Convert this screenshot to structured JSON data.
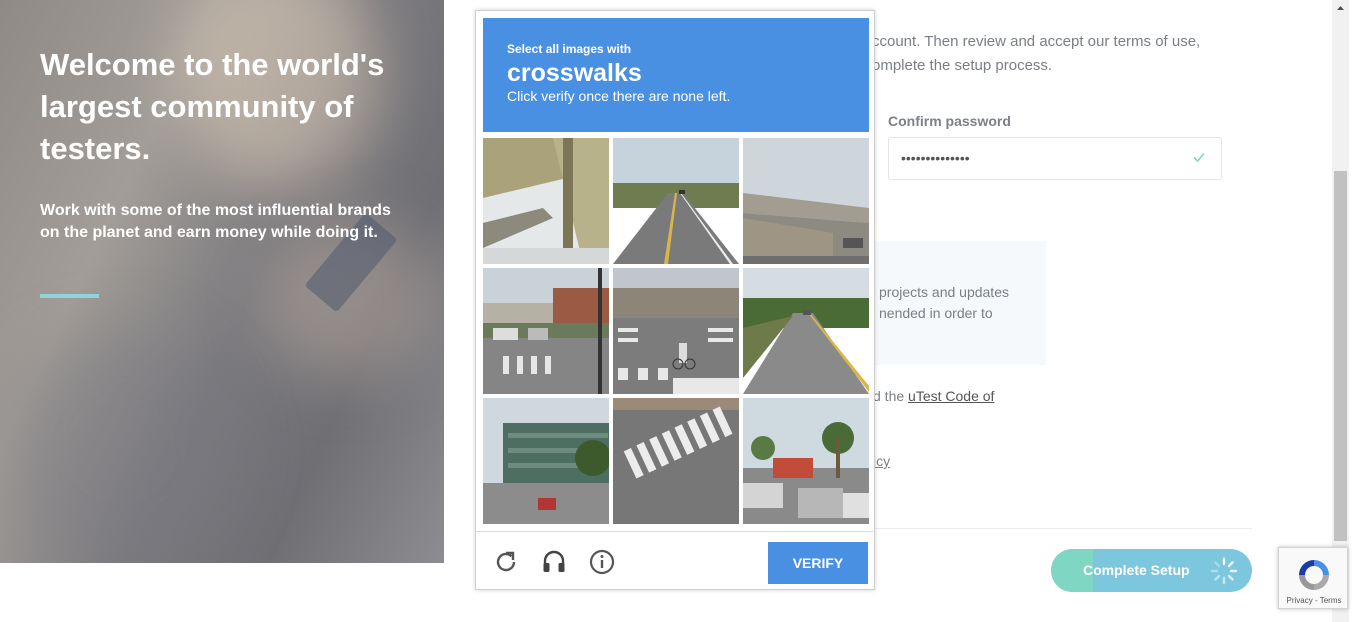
{
  "hero": {
    "title": "Welcome to the world's largest community of testers.",
    "subtitle": "Work with some of the most influential brands on the planet and earn money while doing it."
  },
  "form": {
    "intro_line1": "ccount. Then review and accept our terms of use,",
    "intro_line2": "omplete the setup process.",
    "confirm_label": "Confirm password",
    "confirm_value": "••••••••••••••",
    "info_line1": "projects and updates",
    "info_line2": "nended in order to",
    "code_prefix": "d the ",
    "code_link": "uTest Code of",
    "policy_fragment": "icy",
    "complete_label": "Complete Setup"
  },
  "captcha": {
    "instruction": "Select all images with",
    "keyword": "crosswalks",
    "note": "Click verify once there are none left.",
    "verify_label": "VERIFY",
    "icons": [
      "reload-icon",
      "headphones-icon",
      "info-icon"
    ],
    "tiles": [
      "overpass-underside",
      "two-lane-road",
      "highway-bridge",
      "intersection-parking",
      "crosswalk-cyclist",
      "rural-road",
      "office-building",
      "crosswalk-stripes",
      "parking-lot-palms"
    ]
  },
  "recaptcha_badge": {
    "links": "Privacy - Terms"
  },
  "colors": {
    "captcha_blue": "#4a90e2",
    "accent_teal": "#8fd3dd",
    "button_teal": "#7cc7dd",
    "check_green": "#7fd6c2"
  }
}
